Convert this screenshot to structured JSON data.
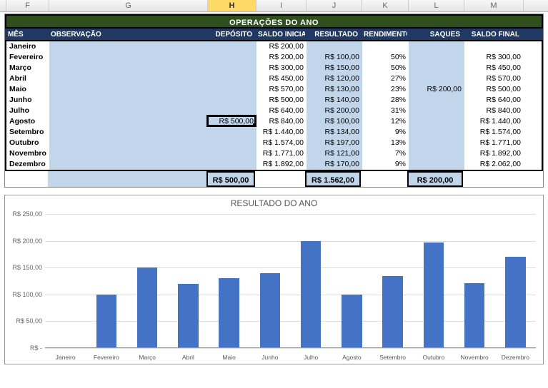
{
  "columns": {
    "letters": [
      "F",
      "G",
      "H",
      "I",
      "J",
      "K",
      "L",
      "M"
    ],
    "selected": "H",
    "widths": [
      60,
      222,
      68,
      70,
      78,
      65,
      78,
      83
    ]
  },
  "title": "OPERAÇÕES DO ANO",
  "headers": {
    "mes": "MÊS",
    "observacao": "OBSERVAÇÃO",
    "deposito": "DEPÓSITO",
    "saldo_inicial": "SALDO INICIAL",
    "resultado": "RESULTADO",
    "rendimento": "RENDIMENTO",
    "saques": "SAQUES",
    "saldo_final": "SALDO FINAL"
  },
  "rows": [
    {
      "mes": "Janeiro",
      "deposito": "",
      "sini": "R$    200,00",
      "res": "",
      "rend": "",
      "saq": "",
      "sfin": ""
    },
    {
      "mes": "Fevereiro",
      "deposito": "",
      "sini": "R$    200,00",
      "res": "R$      100,00",
      "rend": "50%",
      "saq": "",
      "sfin": "R$    300,00"
    },
    {
      "mes": "Março",
      "deposito": "",
      "sini": "R$    300,00",
      "res": "R$      150,00",
      "rend": "50%",
      "saq": "",
      "sfin": "R$    450,00"
    },
    {
      "mes": "Abril",
      "deposito": "",
      "sini": "R$    450,00",
      "res": "R$      120,00",
      "rend": "27%",
      "saq": "",
      "sfin": "R$    570,00"
    },
    {
      "mes": "Maio",
      "deposito": "",
      "sini": "R$    570,00",
      "res": "R$      130,00",
      "rend": "23%",
      "saq": "R$    200,00",
      "sfin": "R$    500,00"
    },
    {
      "mes": "Junho",
      "deposito": "",
      "sini": "R$    500,00",
      "res": "R$      140,00",
      "rend": "28%",
      "saq": "",
      "sfin": "R$    640,00"
    },
    {
      "mes": "Julho",
      "deposito": "",
      "sini": "R$    640,00",
      "res": "R$      200,00",
      "rend": "31%",
      "saq": "",
      "sfin": "R$    840,00"
    },
    {
      "mes": "Agosto",
      "deposito": "R$   500,00",
      "sini": "R$    840,00",
      "res": "R$      100,00",
      "rend": "12%",
      "saq": "",
      "sfin": "R$   1.440,00"
    },
    {
      "mes": "Setembro",
      "deposito": "",
      "sini": "R$   1.440,00",
      "res": "R$      134,00",
      "rend": "9%",
      "saq": "",
      "sfin": "R$   1.574,00"
    },
    {
      "mes": "Outubro",
      "deposito": "",
      "sini": "R$   1.574,00",
      "res": "R$      197,00",
      "rend": "13%",
      "saq": "",
      "sfin": "R$   1.771,00"
    },
    {
      "mes": "Novembro",
      "deposito": "",
      "sini": "R$   1.771,00",
      "res": "R$      121,00",
      "rend": "7%",
      "saq": "",
      "sfin": "R$   1.892,00"
    },
    {
      "mes": "Dezembro",
      "deposito": "",
      "sini": "R$   1.892,00",
      "res": "R$      170,00",
      "rend": "9%",
      "saq": "",
      "sfin": "R$  2.062,00"
    }
  ],
  "totals": {
    "deposito": "R$ 500,00",
    "resultado": "R$ 1.562,00",
    "saques": "R$ 200,00"
  },
  "active_cell": {
    "row_mes": "Agosto",
    "value": "R$   500,00"
  },
  "chart_data": {
    "type": "bar",
    "title": "RESULTADO  DO ANO",
    "categories": [
      "Janeiro",
      "Fevereiro",
      "Março",
      "Abril",
      "Maio",
      "Junho",
      "Julho",
      "Agosto",
      "Setembro",
      "Outubro",
      "Novembro",
      "Dezembro"
    ],
    "values": [
      0,
      100,
      150,
      120,
      130,
      140,
      200,
      100,
      134,
      197,
      121,
      170
    ],
    "ylabel": "",
    "xlabel": "",
    "ylim": [
      0,
      250
    ],
    "yticks": [
      0,
      50,
      100,
      150,
      200,
      250
    ],
    "ytick_labels": [
      "R$ -",
      "R$ 50,00",
      "R$ 100,00",
      "R$ 150,00",
      "R$ 200,00",
      "R$ 250,00"
    ]
  }
}
